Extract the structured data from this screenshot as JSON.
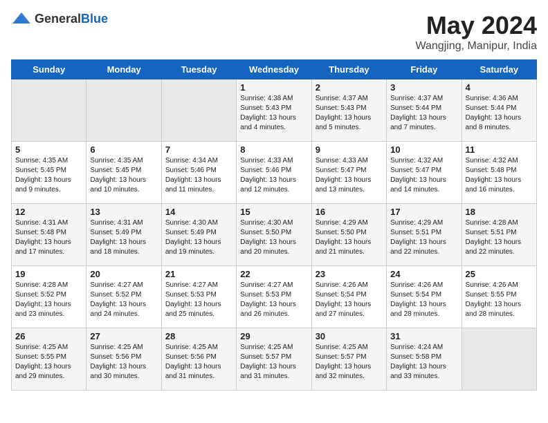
{
  "header": {
    "logo_general": "General",
    "logo_blue": "Blue",
    "main_title": "May 2024",
    "sub_title": "Wangjing, Manipur, India"
  },
  "weekdays": [
    "Sunday",
    "Monday",
    "Tuesday",
    "Wednesday",
    "Thursday",
    "Friday",
    "Saturday"
  ],
  "weeks": [
    [
      {
        "day": "",
        "sunrise": "",
        "sunset": "",
        "daylight": ""
      },
      {
        "day": "",
        "sunrise": "",
        "sunset": "",
        "daylight": ""
      },
      {
        "day": "",
        "sunrise": "",
        "sunset": "",
        "daylight": ""
      },
      {
        "day": "1",
        "sunrise": "Sunrise: 4:38 AM",
        "sunset": "Sunset: 5:43 PM",
        "daylight": "Daylight: 13 hours and 4 minutes."
      },
      {
        "day": "2",
        "sunrise": "Sunrise: 4:37 AM",
        "sunset": "Sunset: 5:43 PM",
        "daylight": "Daylight: 13 hours and 5 minutes."
      },
      {
        "day": "3",
        "sunrise": "Sunrise: 4:37 AM",
        "sunset": "Sunset: 5:44 PM",
        "daylight": "Daylight: 13 hours and 7 minutes."
      },
      {
        "day": "4",
        "sunrise": "Sunrise: 4:36 AM",
        "sunset": "Sunset: 5:44 PM",
        "daylight": "Daylight: 13 hours and 8 minutes."
      }
    ],
    [
      {
        "day": "5",
        "sunrise": "Sunrise: 4:35 AM",
        "sunset": "Sunset: 5:45 PM",
        "daylight": "Daylight: 13 hours and 9 minutes."
      },
      {
        "day": "6",
        "sunrise": "Sunrise: 4:35 AM",
        "sunset": "Sunset: 5:45 PM",
        "daylight": "Daylight: 13 hours and 10 minutes."
      },
      {
        "day": "7",
        "sunrise": "Sunrise: 4:34 AM",
        "sunset": "Sunset: 5:46 PM",
        "daylight": "Daylight: 13 hours and 11 minutes."
      },
      {
        "day": "8",
        "sunrise": "Sunrise: 4:33 AM",
        "sunset": "Sunset: 5:46 PM",
        "daylight": "Daylight: 13 hours and 12 minutes."
      },
      {
        "day": "9",
        "sunrise": "Sunrise: 4:33 AM",
        "sunset": "Sunset: 5:47 PM",
        "daylight": "Daylight: 13 hours and 13 minutes."
      },
      {
        "day": "10",
        "sunrise": "Sunrise: 4:32 AM",
        "sunset": "Sunset: 5:47 PM",
        "daylight": "Daylight: 13 hours and 14 minutes."
      },
      {
        "day": "11",
        "sunrise": "Sunrise: 4:32 AM",
        "sunset": "Sunset: 5:48 PM",
        "daylight": "Daylight: 13 hours and 16 minutes."
      }
    ],
    [
      {
        "day": "12",
        "sunrise": "Sunrise: 4:31 AM",
        "sunset": "Sunset: 5:48 PM",
        "daylight": "Daylight: 13 hours and 17 minutes."
      },
      {
        "day": "13",
        "sunrise": "Sunrise: 4:31 AM",
        "sunset": "Sunset: 5:49 PM",
        "daylight": "Daylight: 13 hours and 18 minutes."
      },
      {
        "day": "14",
        "sunrise": "Sunrise: 4:30 AM",
        "sunset": "Sunset: 5:49 PM",
        "daylight": "Daylight: 13 hours and 19 minutes."
      },
      {
        "day": "15",
        "sunrise": "Sunrise: 4:30 AM",
        "sunset": "Sunset: 5:50 PM",
        "daylight": "Daylight: 13 hours and 20 minutes."
      },
      {
        "day": "16",
        "sunrise": "Sunrise: 4:29 AM",
        "sunset": "Sunset: 5:50 PM",
        "daylight": "Daylight: 13 hours and 21 minutes."
      },
      {
        "day": "17",
        "sunrise": "Sunrise: 4:29 AM",
        "sunset": "Sunset: 5:51 PM",
        "daylight": "Daylight: 13 hours and 22 minutes."
      },
      {
        "day": "18",
        "sunrise": "Sunrise: 4:28 AM",
        "sunset": "Sunset: 5:51 PM",
        "daylight": "Daylight: 13 hours and 22 minutes."
      }
    ],
    [
      {
        "day": "19",
        "sunrise": "Sunrise: 4:28 AM",
        "sunset": "Sunset: 5:52 PM",
        "daylight": "Daylight: 13 hours and 23 minutes."
      },
      {
        "day": "20",
        "sunrise": "Sunrise: 4:27 AM",
        "sunset": "Sunset: 5:52 PM",
        "daylight": "Daylight: 13 hours and 24 minutes."
      },
      {
        "day": "21",
        "sunrise": "Sunrise: 4:27 AM",
        "sunset": "Sunset: 5:53 PM",
        "daylight": "Daylight: 13 hours and 25 minutes."
      },
      {
        "day": "22",
        "sunrise": "Sunrise: 4:27 AM",
        "sunset": "Sunset: 5:53 PM",
        "daylight": "Daylight: 13 hours and 26 minutes."
      },
      {
        "day": "23",
        "sunrise": "Sunrise: 4:26 AM",
        "sunset": "Sunset: 5:54 PM",
        "daylight": "Daylight: 13 hours and 27 minutes."
      },
      {
        "day": "24",
        "sunrise": "Sunrise: 4:26 AM",
        "sunset": "Sunset: 5:54 PM",
        "daylight": "Daylight: 13 hours and 28 minutes."
      },
      {
        "day": "25",
        "sunrise": "Sunrise: 4:26 AM",
        "sunset": "Sunset: 5:55 PM",
        "daylight": "Daylight: 13 hours and 28 minutes."
      }
    ],
    [
      {
        "day": "26",
        "sunrise": "Sunrise: 4:25 AM",
        "sunset": "Sunset: 5:55 PM",
        "daylight": "Daylight: 13 hours and 29 minutes."
      },
      {
        "day": "27",
        "sunrise": "Sunrise: 4:25 AM",
        "sunset": "Sunset: 5:56 PM",
        "daylight": "Daylight: 13 hours and 30 minutes."
      },
      {
        "day": "28",
        "sunrise": "Sunrise: 4:25 AM",
        "sunset": "Sunset: 5:56 PM",
        "daylight": "Daylight: 13 hours and 31 minutes."
      },
      {
        "day": "29",
        "sunrise": "Sunrise: 4:25 AM",
        "sunset": "Sunset: 5:57 PM",
        "daylight": "Daylight: 13 hours and 31 minutes."
      },
      {
        "day": "30",
        "sunrise": "Sunrise: 4:25 AM",
        "sunset": "Sunset: 5:57 PM",
        "daylight": "Daylight: 13 hours and 32 minutes."
      },
      {
        "day": "31",
        "sunrise": "Sunrise: 4:24 AM",
        "sunset": "Sunset: 5:58 PM",
        "daylight": "Daylight: 13 hours and 33 minutes."
      },
      {
        "day": "",
        "sunrise": "",
        "sunset": "",
        "daylight": ""
      }
    ]
  ]
}
